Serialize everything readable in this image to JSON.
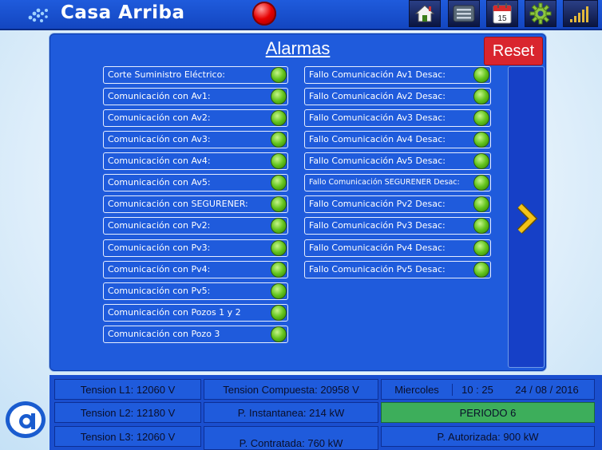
{
  "header": {
    "app_title": "Casa Arriba",
    "icons": [
      "logo-dots-icon",
      "alarm-indicator",
      "home-icon",
      "panel-icon",
      "calendar-icon",
      "gear-icon",
      "signal-icon"
    ],
    "calendar_day": "15",
    "colors": {
      "bar": "#1f5bdc",
      "alarm_led": "#e60000"
    }
  },
  "alarms": {
    "title": "Alarmas",
    "reset_label": "Reset",
    "left": [
      "Corte Suministro Eléctrico:",
      "Comunicación con Av1:",
      "Comunicación con Av2:",
      "Comunicación con Av3:",
      "Comunicación con Av4:",
      "Comunicación con Av5:",
      "Comunicación con SEGURENER:",
      "Comunicación con Pv2:",
      "Comunicación con Pv3:",
      "Comunicación con Pv4:",
      "Comunicación con Pv5:",
      "Comunicación con Pozos 1 y 2",
      "Comunicación con Pozo 3"
    ],
    "right": [
      "Fallo Comunicación Av1 Desac:",
      "Fallo Comunicación Av2 Desac:",
      "Fallo Comunicación Av3 Desac:",
      "Fallo Comunicación Av4 Desac:",
      "Fallo Comunicación Av5 Desac:",
      "Fallo Comunicación SEGURENER Desac:",
      "Fallo Comunicación Pv2 Desac:",
      "Fallo Comunicación Pv3 Desac:",
      "Fallo Comunicación Pv4 Desac:",
      "Fallo Comunicación Pv5 Desac:"
    ],
    "led_state": "ok",
    "led_color": "#62c31c"
  },
  "status": {
    "tension_l1": "Tension L1: 12060 V",
    "tension_l2": "Tension L2: 12180 V",
    "tension_l3": "Tension L3: 12060 V",
    "tension_compuesta": "Tension Compuesta: 20958 V",
    "p_instantanea": "P. Instantanea: 214 kW",
    "p_contratada": "P. Contratada: 760 kW",
    "day": "Miercoles",
    "time": "10 : 25",
    "date": "24 / 08 / 2016",
    "periodo": "PERIODO 6",
    "periodo_color": "#3dae5b",
    "p_autorizada": "P. Autorizada: 900 kW"
  }
}
